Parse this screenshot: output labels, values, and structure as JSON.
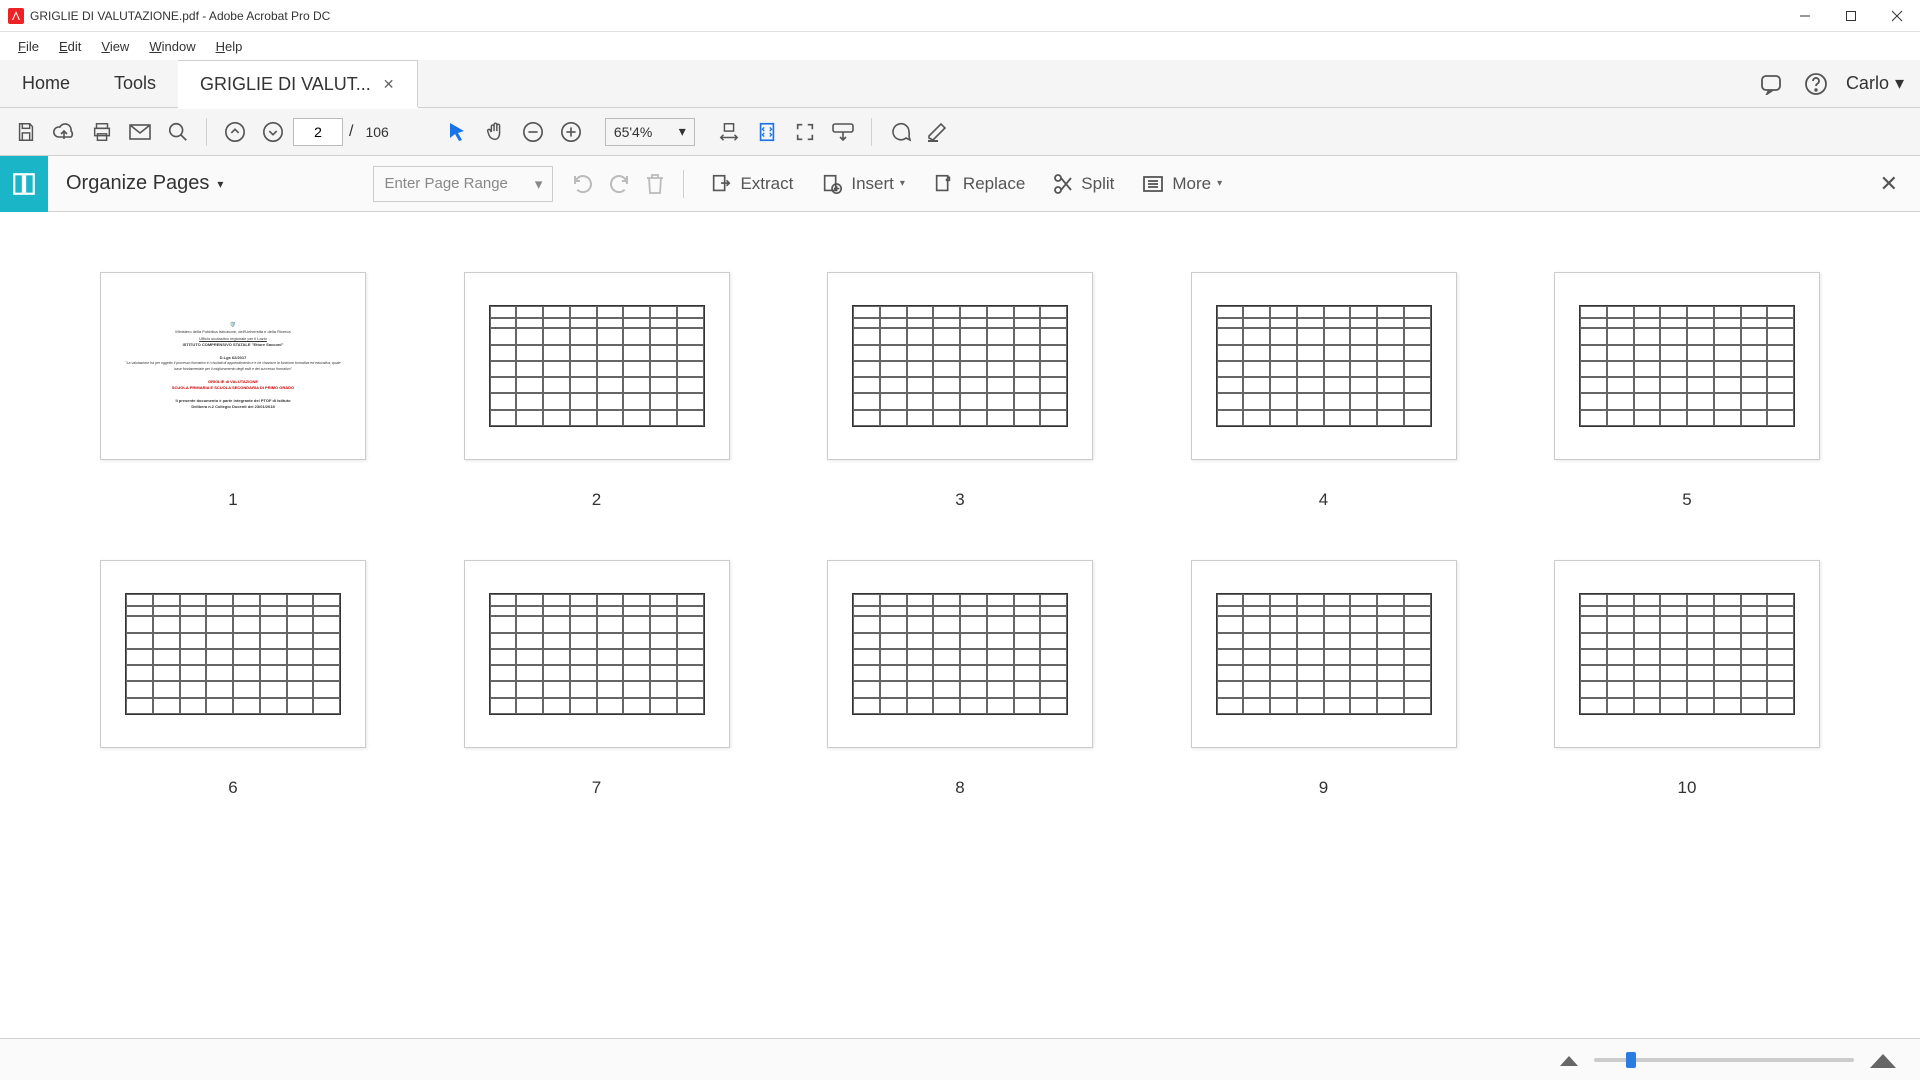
{
  "window": {
    "title": "GRIGLIE DI VALUTAZIONE.pdf - Adobe Acrobat Pro DC"
  },
  "menubar": {
    "file": "File",
    "edit": "Edit",
    "view": "View",
    "window": "Window",
    "help": "Help"
  },
  "tabs": {
    "home": "Home",
    "tools": "Tools",
    "doc": "GRIGLIE DI VALUT...",
    "user": "Carlo"
  },
  "toolbar": {
    "current_page": "2",
    "page_sep": "/",
    "total_pages": "106",
    "zoom": "65'4%"
  },
  "organize": {
    "title": "Organize Pages",
    "range_placeholder": "Enter Page Range",
    "extract": "Extract",
    "insert": "Insert",
    "replace": "Replace",
    "split": "Split",
    "more": "More"
  },
  "thumbs": {
    "labels": [
      "1",
      "2",
      "3",
      "4",
      "5",
      "6",
      "7",
      "8",
      "9",
      "10"
    ]
  },
  "title_page": {
    "ministry": "Ministero della Pubblica Istruzione, dell'Università e della Ricerca",
    "ufficio": "Ufficio scolastico regionale per il Lazio",
    "istituto": "ISTITUTO COMPRENSIVO STATALE \"Ettore Sacconi\"",
    "dlgs": "D.Lgs 62/2017",
    "quote": "\"La valutazione ha per oggetto il processo formativo e i risultati di apprendimento e e ne chiarisce la funzione formativa ed educativa, quale base fondamentale per il miglioramento degli esiti e del successo formativo\"",
    "griglie": "GRIGLIE di VALUTAZIONE",
    "scuola": "SCUOLA  PRIMARIA E SCUOLA SECONDARIA DI PRIMO GRADO",
    "footer1": "Il presente documento è parte integrante del PTOF di Istituto",
    "footer2": "Delibera n.2 Collegio Docenti del 23/01/2018"
  }
}
